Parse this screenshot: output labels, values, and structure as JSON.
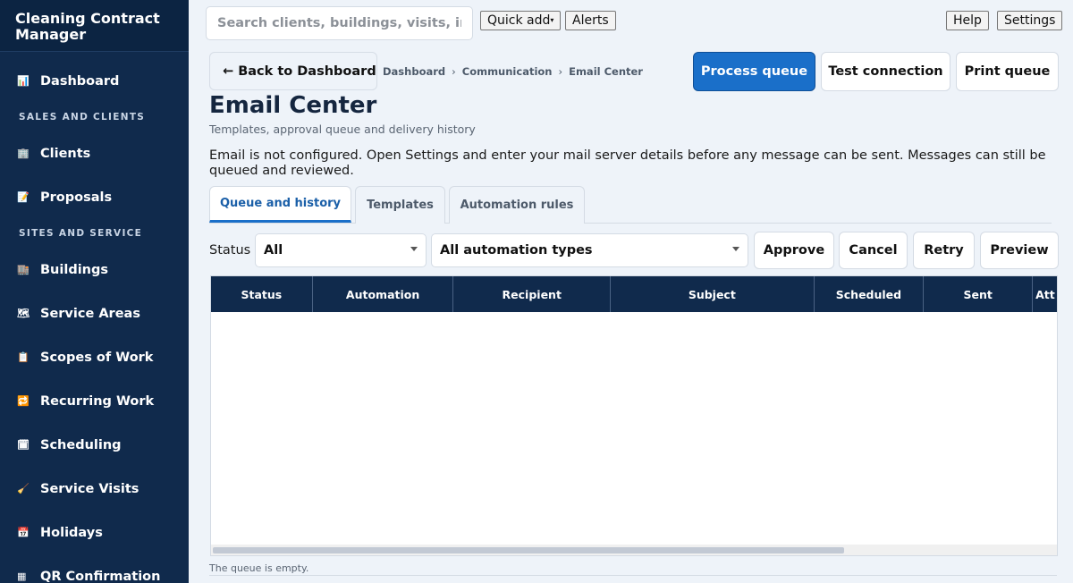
{
  "sidebar": {
    "title": "Cleaning Contract Manager",
    "items": [
      {
        "label": "Dashboard",
        "icon": "📊"
      },
      {
        "section": "SALES AND CLIENTS"
      },
      {
        "label": "Clients",
        "icon": "🏢"
      },
      {
        "label": "Proposals",
        "icon": "📝"
      },
      {
        "section": "SITES AND SERVICE"
      },
      {
        "label": "Buildings",
        "icon": "🏬"
      },
      {
        "label": "Service Areas",
        "icon": "🗺"
      },
      {
        "label": "Scopes of Work",
        "icon": "📋"
      },
      {
        "label": "Recurring Work",
        "icon": "🔁"
      },
      {
        "label": "Scheduling",
        "icon": "🗓"
      },
      {
        "label": "Service Visits",
        "icon": "🧹"
      },
      {
        "label": "Holidays",
        "icon": "📅"
      },
      {
        "label": "QR Confirmation",
        "icon": "▦"
      }
    ]
  },
  "topbar": {
    "search_placeholder": "Search clients, buildings, visits, in...",
    "quick_add": "Quick add",
    "alerts": "Alerts",
    "help": "Help",
    "settings": "Settings"
  },
  "header": {
    "back": "← Back to Dashboard",
    "breadcrumb": [
      "Dashboard",
      "Communication",
      "Email Center"
    ],
    "process_queue": "Process queue",
    "test_connection": "Test connection",
    "print_queue": "Print queue",
    "title": "Email Center",
    "subtitle": "Templates, approval queue and delivery history",
    "notice": "Email is not configured. Open Settings and enter your mail server details before any message can be sent. Messages can still be queued and reviewed."
  },
  "tabs": [
    {
      "label": "Queue and history",
      "active": true
    },
    {
      "label": "Templates",
      "active": false
    },
    {
      "label": "Automation rules",
      "active": false
    }
  ],
  "filters": {
    "status_label": "Status",
    "status_value": "All",
    "automation_value": "All automation types",
    "approve": "Approve",
    "cancel": "Cancel",
    "retry": "Retry",
    "preview": "Preview"
  },
  "table": {
    "columns": [
      "Status",
      "Automation",
      "Recipient",
      "Subject",
      "Scheduled",
      "Sent",
      "Att"
    ],
    "empty_text": "The queue is empty."
  },
  "colors": {
    "sidebar": "#102a4c",
    "primary": "#1a6fc9",
    "background": "#eef3f9"
  }
}
